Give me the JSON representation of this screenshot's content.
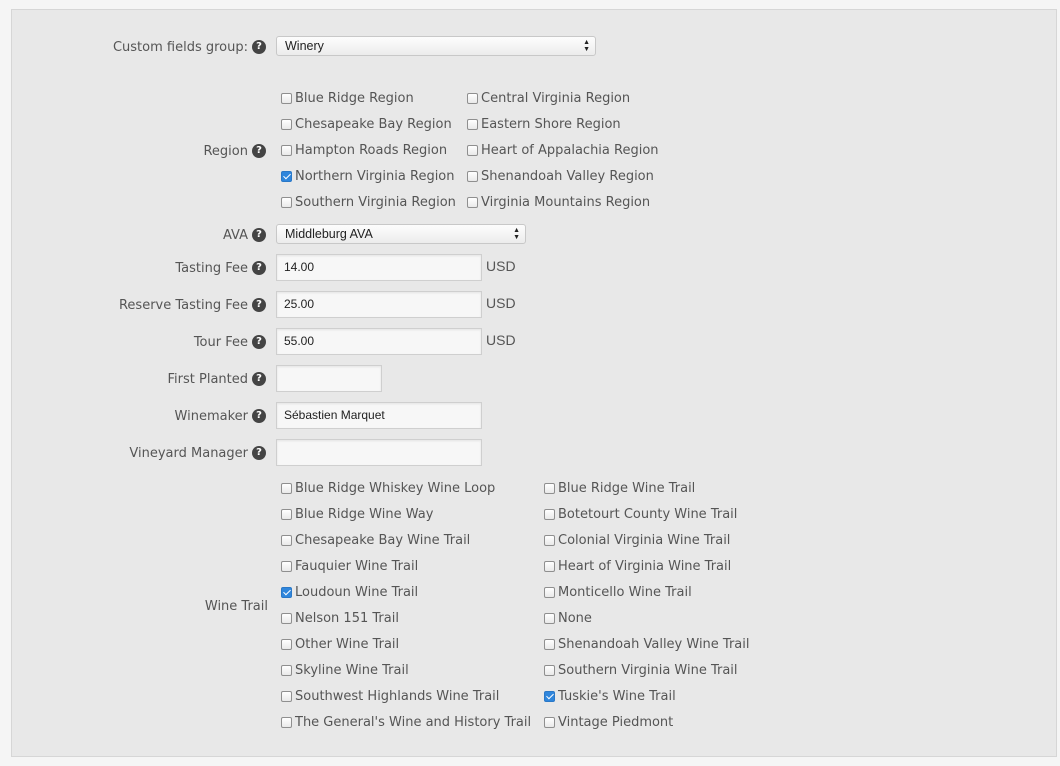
{
  "custom_fields_group": {
    "label": "Custom fields group:",
    "value": "Winery"
  },
  "region": {
    "label": "Region",
    "options": [
      {
        "label": "Blue Ridge Region",
        "checked": false
      },
      {
        "label": "Central Virginia Region",
        "checked": false
      },
      {
        "label": "Chesapeake Bay Region",
        "checked": false
      },
      {
        "label": "Eastern Shore Region",
        "checked": false
      },
      {
        "label": "Hampton Roads Region",
        "checked": false
      },
      {
        "label": "Heart of Appalachia Region",
        "checked": false
      },
      {
        "label": "Northern Virginia Region",
        "checked": true
      },
      {
        "label": "Shenandoah Valley Region",
        "checked": false
      },
      {
        "label": "Southern Virginia Region",
        "checked": false
      },
      {
        "label": "Virginia Mountains Region",
        "checked": false
      }
    ]
  },
  "ava": {
    "label": "AVA",
    "value": "Middleburg AVA"
  },
  "tasting_fee": {
    "label": "Tasting Fee",
    "value": "14.00",
    "unit": "USD"
  },
  "reserve_tasting_fee": {
    "label": "Reserve Tasting Fee",
    "value": "25.00",
    "unit": "USD"
  },
  "tour_fee": {
    "label": "Tour Fee",
    "value": "55.00",
    "unit": "USD"
  },
  "first_planted": {
    "label": "First Planted",
    "value": ""
  },
  "winemaker": {
    "label": "Winemaker",
    "value": "Sébastien Marquet"
  },
  "vineyard_manager": {
    "label": "Vineyard Manager",
    "value": ""
  },
  "wine_trail": {
    "label": "Wine Trail",
    "options": [
      {
        "label": "Blue Ridge Whiskey Wine Loop",
        "checked": false
      },
      {
        "label": "Blue Ridge Wine Trail",
        "checked": false
      },
      {
        "label": "Blue Ridge Wine Way",
        "checked": false
      },
      {
        "label": "Botetourt County Wine Trail",
        "checked": false
      },
      {
        "label": "Chesapeake Bay Wine Trail",
        "checked": false
      },
      {
        "label": "Colonial Virginia Wine Trail",
        "checked": false
      },
      {
        "label": "Fauquier Wine Trail",
        "checked": false
      },
      {
        "label": "Heart of Virginia Wine Trail",
        "checked": false
      },
      {
        "label": "Loudoun Wine Trail",
        "checked": true
      },
      {
        "label": "Monticello Wine Trail",
        "checked": false
      },
      {
        "label": "Nelson 151 Trail",
        "checked": false
      },
      {
        "label": "None",
        "checked": false
      },
      {
        "label": "Other Wine Trail",
        "checked": false
      },
      {
        "label": "Shenandoah Valley Wine Trail",
        "checked": false
      },
      {
        "label": "Skyline Wine Trail",
        "checked": false
      },
      {
        "label": "Southern Virginia Wine Trail",
        "checked": false
      },
      {
        "label": "Southwest Highlands Wine Trail",
        "checked": false
      },
      {
        "label": "Tuskie's Wine Trail",
        "checked": true
      },
      {
        "label": "The General's Wine and History Trail",
        "checked": false
      },
      {
        "label": "Vintage Piedmont",
        "checked": false
      }
    ]
  },
  "icons": {
    "help": "question-circle-icon",
    "checkbox_checked_color": "#2f86dc"
  }
}
